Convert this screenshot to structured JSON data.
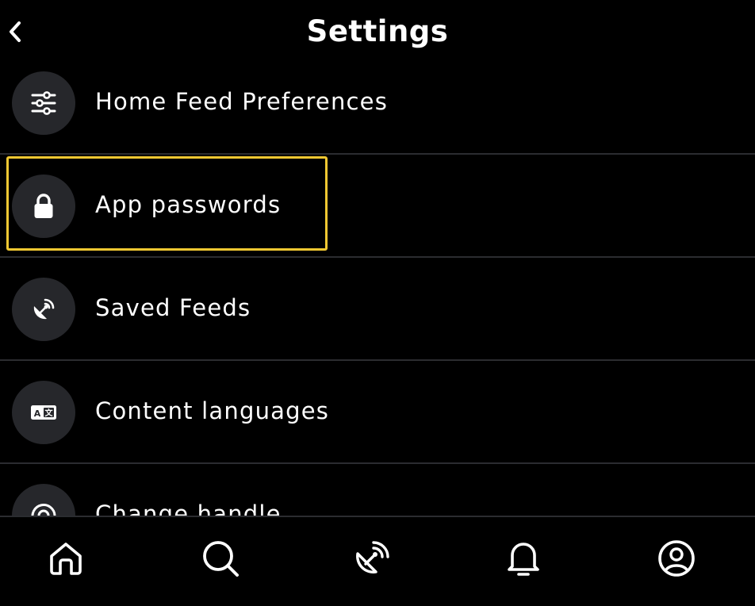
{
  "header": {
    "title": "Settings",
    "back_icon": "chevron-left-icon"
  },
  "settings": {
    "items": [
      {
        "label": "Home Feed Preferences",
        "icon": "sliders-icon"
      },
      {
        "label": "App passwords",
        "icon": "lock-icon",
        "highlighted": true
      },
      {
        "label": "Saved Feeds",
        "icon": "satellite-dish-icon"
      },
      {
        "label": "Content languages",
        "icon": "translate-icon"
      },
      {
        "label": "Change handle",
        "icon": "at-sign-icon"
      }
    ]
  },
  "bottom_nav": {
    "tabs": [
      {
        "name": "home",
        "icon": "home-icon"
      },
      {
        "name": "search",
        "icon": "search-icon"
      },
      {
        "name": "feeds",
        "icon": "satellite-dish-icon"
      },
      {
        "name": "notifications",
        "icon": "bell-icon"
      },
      {
        "name": "profile",
        "icon": "user-circle-icon"
      }
    ]
  },
  "colors": {
    "background": "#000000",
    "icon_circle": "#26272b",
    "divider": "#2b2c30",
    "highlight": "#f2c832",
    "text": "#ffffff"
  }
}
